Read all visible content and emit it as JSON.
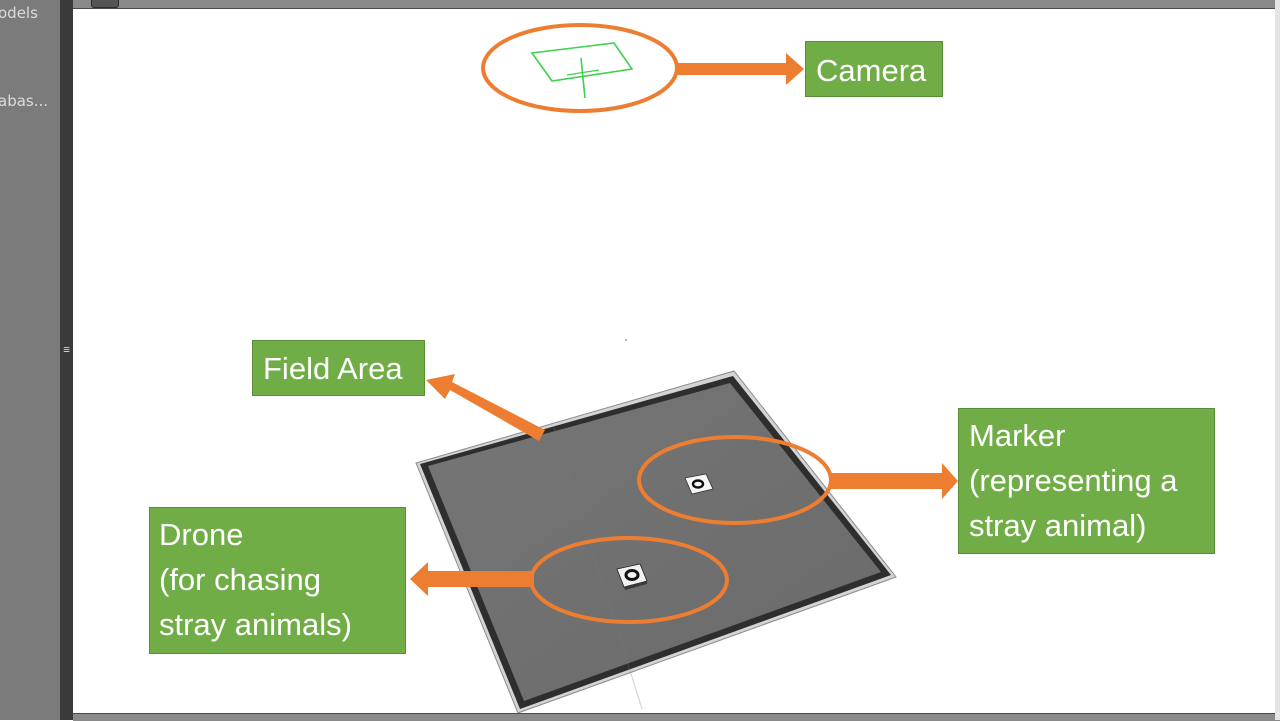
{
  "left_panel": {
    "items": [
      {
        "label": "odels"
      },
      {
        "label": "abas..."
      }
    ]
  },
  "splitter": {
    "grip_icon": "vertical-grip-icon",
    "glyph": "≡"
  },
  "viewport": {
    "scene": {
      "field_color": "#707070",
      "callout_color": "#ed7d31",
      "label_color": "#70ad47",
      "camera_wireframe_color": "#3ed14b"
    },
    "labels": {
      "camera": "Camera",
      "field_area": "Field Area",
      "marker_line1": "Marker",
      "marker_line2": "(representing a",
      "marker_line3": "stray animal)",
      "drone_line1": "Drone",
      "drone_line2": "(for chasing",
      "drone_line3": "stray animals)"
    }
  }
}
